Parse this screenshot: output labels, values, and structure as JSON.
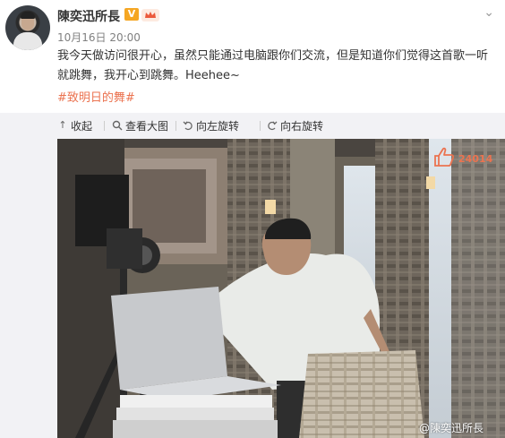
{
  "post": {
    "username": "陳奕迅所長",
    "vip_badge": "V",
    "time": "10月16日 20:00",
    "text": "我今天做访问很开心，虽然只能通过电脑跟你们交流，但是知道你们觉得这首歌一听就跳舞，我开心到跳舞。Heehee~",
    "hashtag": "#致明日的舞#"
  },
  "toolbar": {
    "collapse": "收起",
    "view_large": "查看大图",
    "rotate_left": "向左旋转",
    "rotate_right": "向右旋转"
  },
  "photo": {
    "like_count": "24014",
    "watermark": "@陳奕迅所長"
  },
  "icons": {
    "more": "chevron-down-icon",
    "collapse": "collapse-arrow-icon",
    "view_large": "magnify-icon",
    "rotate_left": "rotate-left-icon",
    "rotate_right": "rotate-right-icon",
    "like": "thumbs-up-icon"
  },
  "colors": {
    "accent": "#eb7350",
    "vip": "#f5a623",
    "band": "#f2f2f5"
  }
}
